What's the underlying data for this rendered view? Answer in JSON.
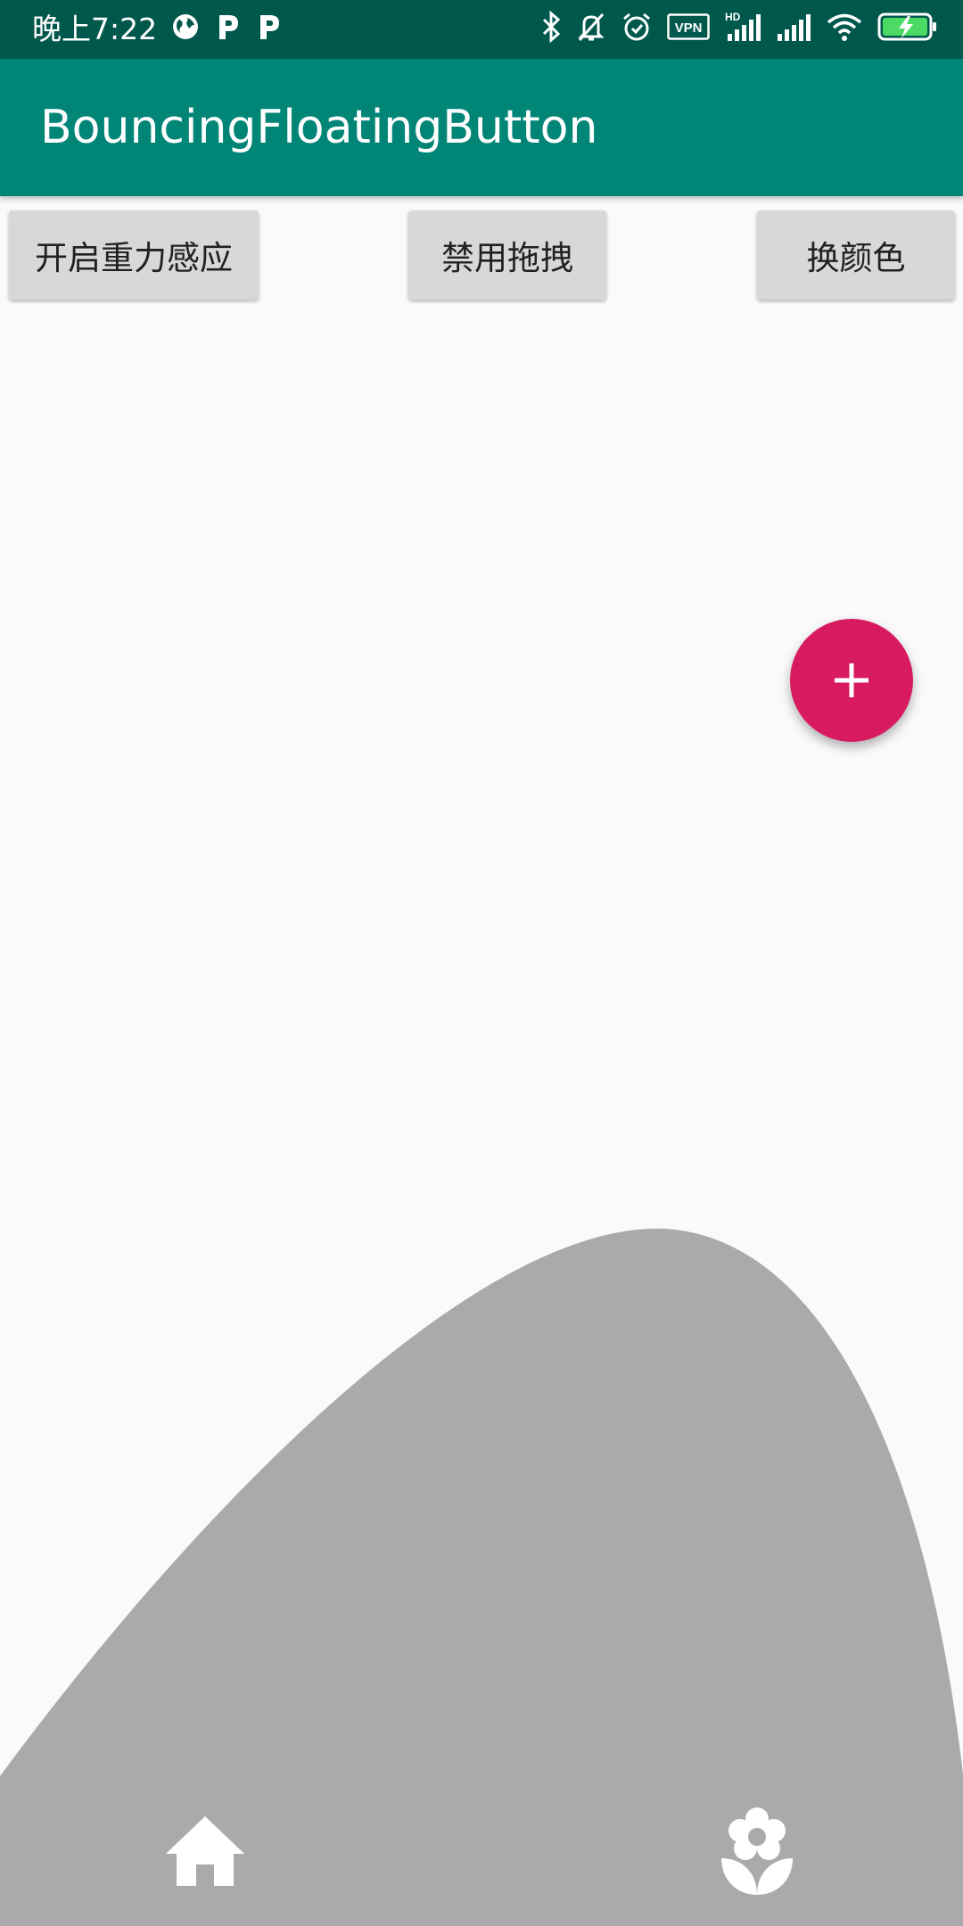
{
  "status_bar": {
    "time": "晚上7:22",
    "left_icons": [
      "globe-icon",
      "parking-icon",
      "parking-icon"
    ],
    "right_icons": [
      "bluetooth-icon",
      "bell-off-icon",
      "alarm-icon",
      "vpn-icon",
      "signal-hd-icon",
      "signal-icon",
      "wifi-icon",
      "battery-charging-icon"
    ],
    "vpn_label": "VPN",
    "hd_label": "HD",
    "background": "#00574b"
  },
  "appbar": {
    "title": "BouncingFloatingButton",
    "background": "#008577"
  },
  "buttons": {
    "gravity": "开启重力感应",
    "drag": "禁用拖拽",
    "color": "换颜色"
  },
  "fab": {
    "icon": "plus-icon",
    "color": "#d81b60"
  },
  "bottom_nav": {
    "background": "#aaaaaa",
    "items": [
      {
        "icon": "home-icon"
      },
      {
        "icon": "flower-icon"
      }
    ]
  }
}
